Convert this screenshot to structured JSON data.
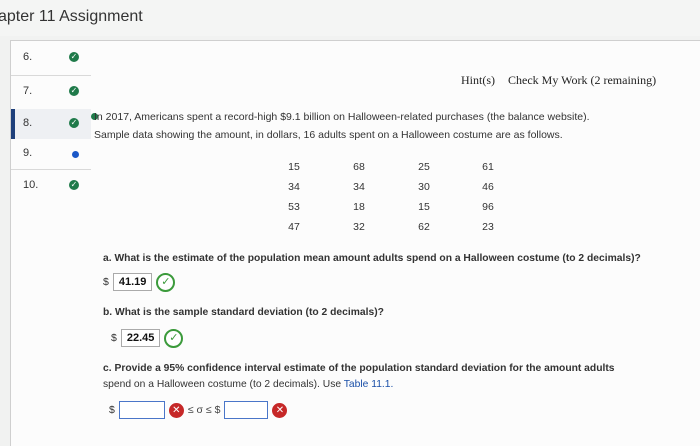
{
  "header": {
    "title": "apter 11 Assignment"
  },
  "nav": {
    "items": [
      {
        "label": "6."
      },
      {
        "label": "7."
      },
      {
        "label": "8."
      },
      {
        "label": "9."
      },
      {
        "label": "10."
      }
    ]
  },
  "hints": {
    "hint_label": "Hint(s)",
    "check_label": "Check My Work",
    "remaining": "(2 remaining)"
  },
  "intro": {
    "line1": "In 2017, Americans spent a record-high $9.1 billion on Halloween-related purchases (the balance website).",
    "line2": "Sample data showing the amount, in dollars, 16 adults spent on a Halloween costume are as follows."
  },
  "data_rows": [
    [
      "15",
      "68",
      "25",
      "61"
    ],
    [
      "34",
      "34",
      "30",
      "46"
    ],
    [
      "53",
      "18",
      "15",
      "96"
    ],
    [
      "47",
      "32",
      "62",
      "23"
    ]
  ],
  "part_a": {
    "question": "a. What is the estimate of the population mean amount adults spend on a Halloween costume (to 2 decimals)?",
    "currency": "$",
    "answer": "41.19",
    "status": "✓"
  },
  "part_b": {
    "question": "b. What is the sample standard deviation (to 2 decimals)?",
    "currency": "$",
    "answer": "22.45",
    "status": "✓"
  },
  "part_c": {
    "line1": "c. Provide a 95% confidence interval estimate of the population standard deviation for the amount adults",
    "line2_prefix": "spend on a Halloween costume (to 2 decimals). Use ",
    "table_link": "Table 11.1.",
    "currency_left": "$",
    "relation": "≤ σ ≤ $",
    "status": "✕"
  },
  "colors": {
    "accent": "#1e3f7a",
    "correct": "#3b9a3b",
    "wrong": "#c62828",
    "link": "#1a4fa8"
  }
}
